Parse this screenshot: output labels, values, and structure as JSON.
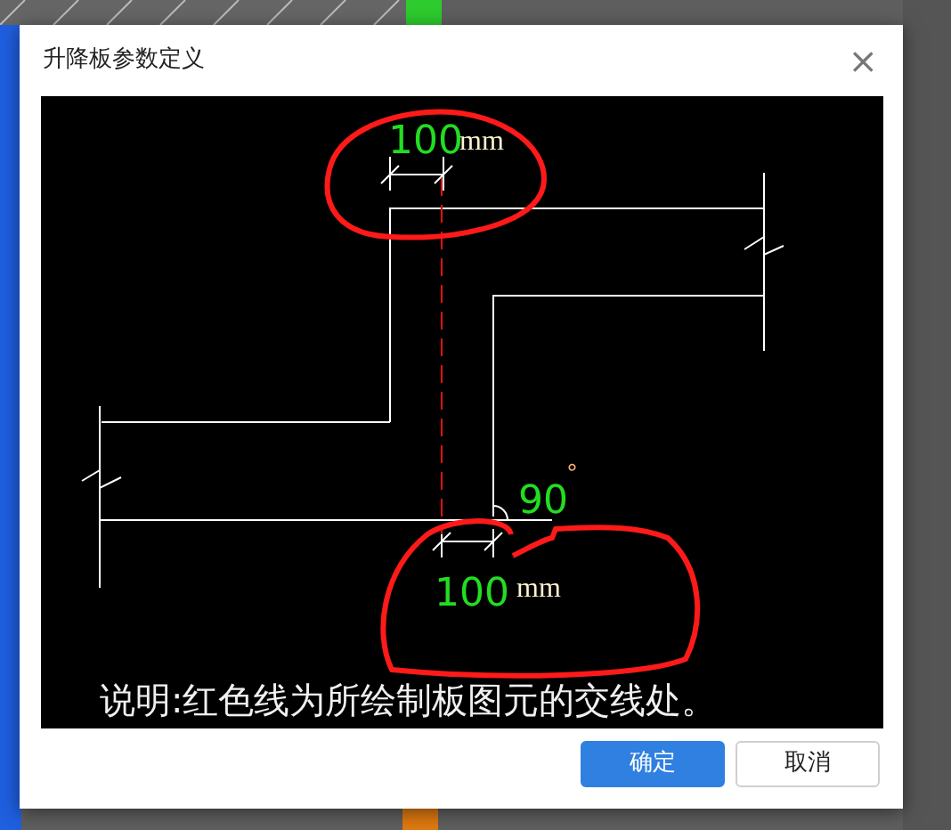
{
  "dialog": {
    "title": "升降板参数定义",
    "close": "×"
  },
  "drawing": {
    "top_dimension": {
      "value": "100",
      "unit": "mm"
    },
    "angle": {
      "value": "90",
      "unit": "°"
    },
    "bottom_dimension": {
      "value": "100",
      "unit": "mm"
    },
    "caption": "说明:红色线为所绘制板图元的交线处。"
  },
  "buttons": [
    {
      "label": "确定",
      "kind": "primary"
    },
    {
      "label": "取消",
      "kind": "secondary"
    }
  ]
}
